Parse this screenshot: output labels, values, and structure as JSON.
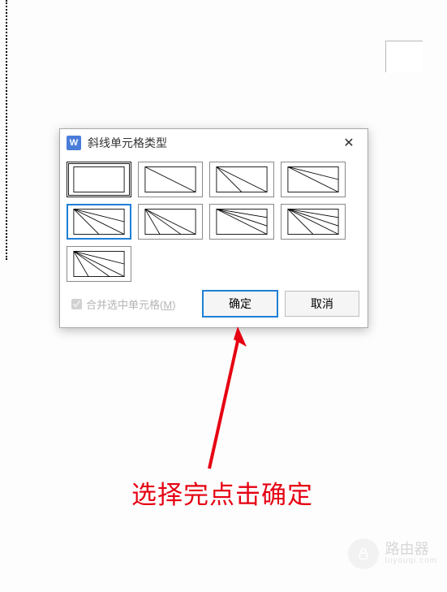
{
  "dialog": {
    "title": "斜线单元格类型",
    "app_icon_letter": "W",
    "close_label": "✕",
    "merge_label_prefix": "合并选中单元格(",
    "merge_label_key": "M",
    "merge_label_suffix": ")",
    "ok_label": "确定",
    "cancel_label": "取消"
  },
  "annotation": "选择完点击确定",
  "watermark": {
    "text": "路由器",
    "sub": "luyouqi.com"
  },
  "colors": {
    "accent": "#1e7fd6",
    "annotation": "#e60012"
  }
}
